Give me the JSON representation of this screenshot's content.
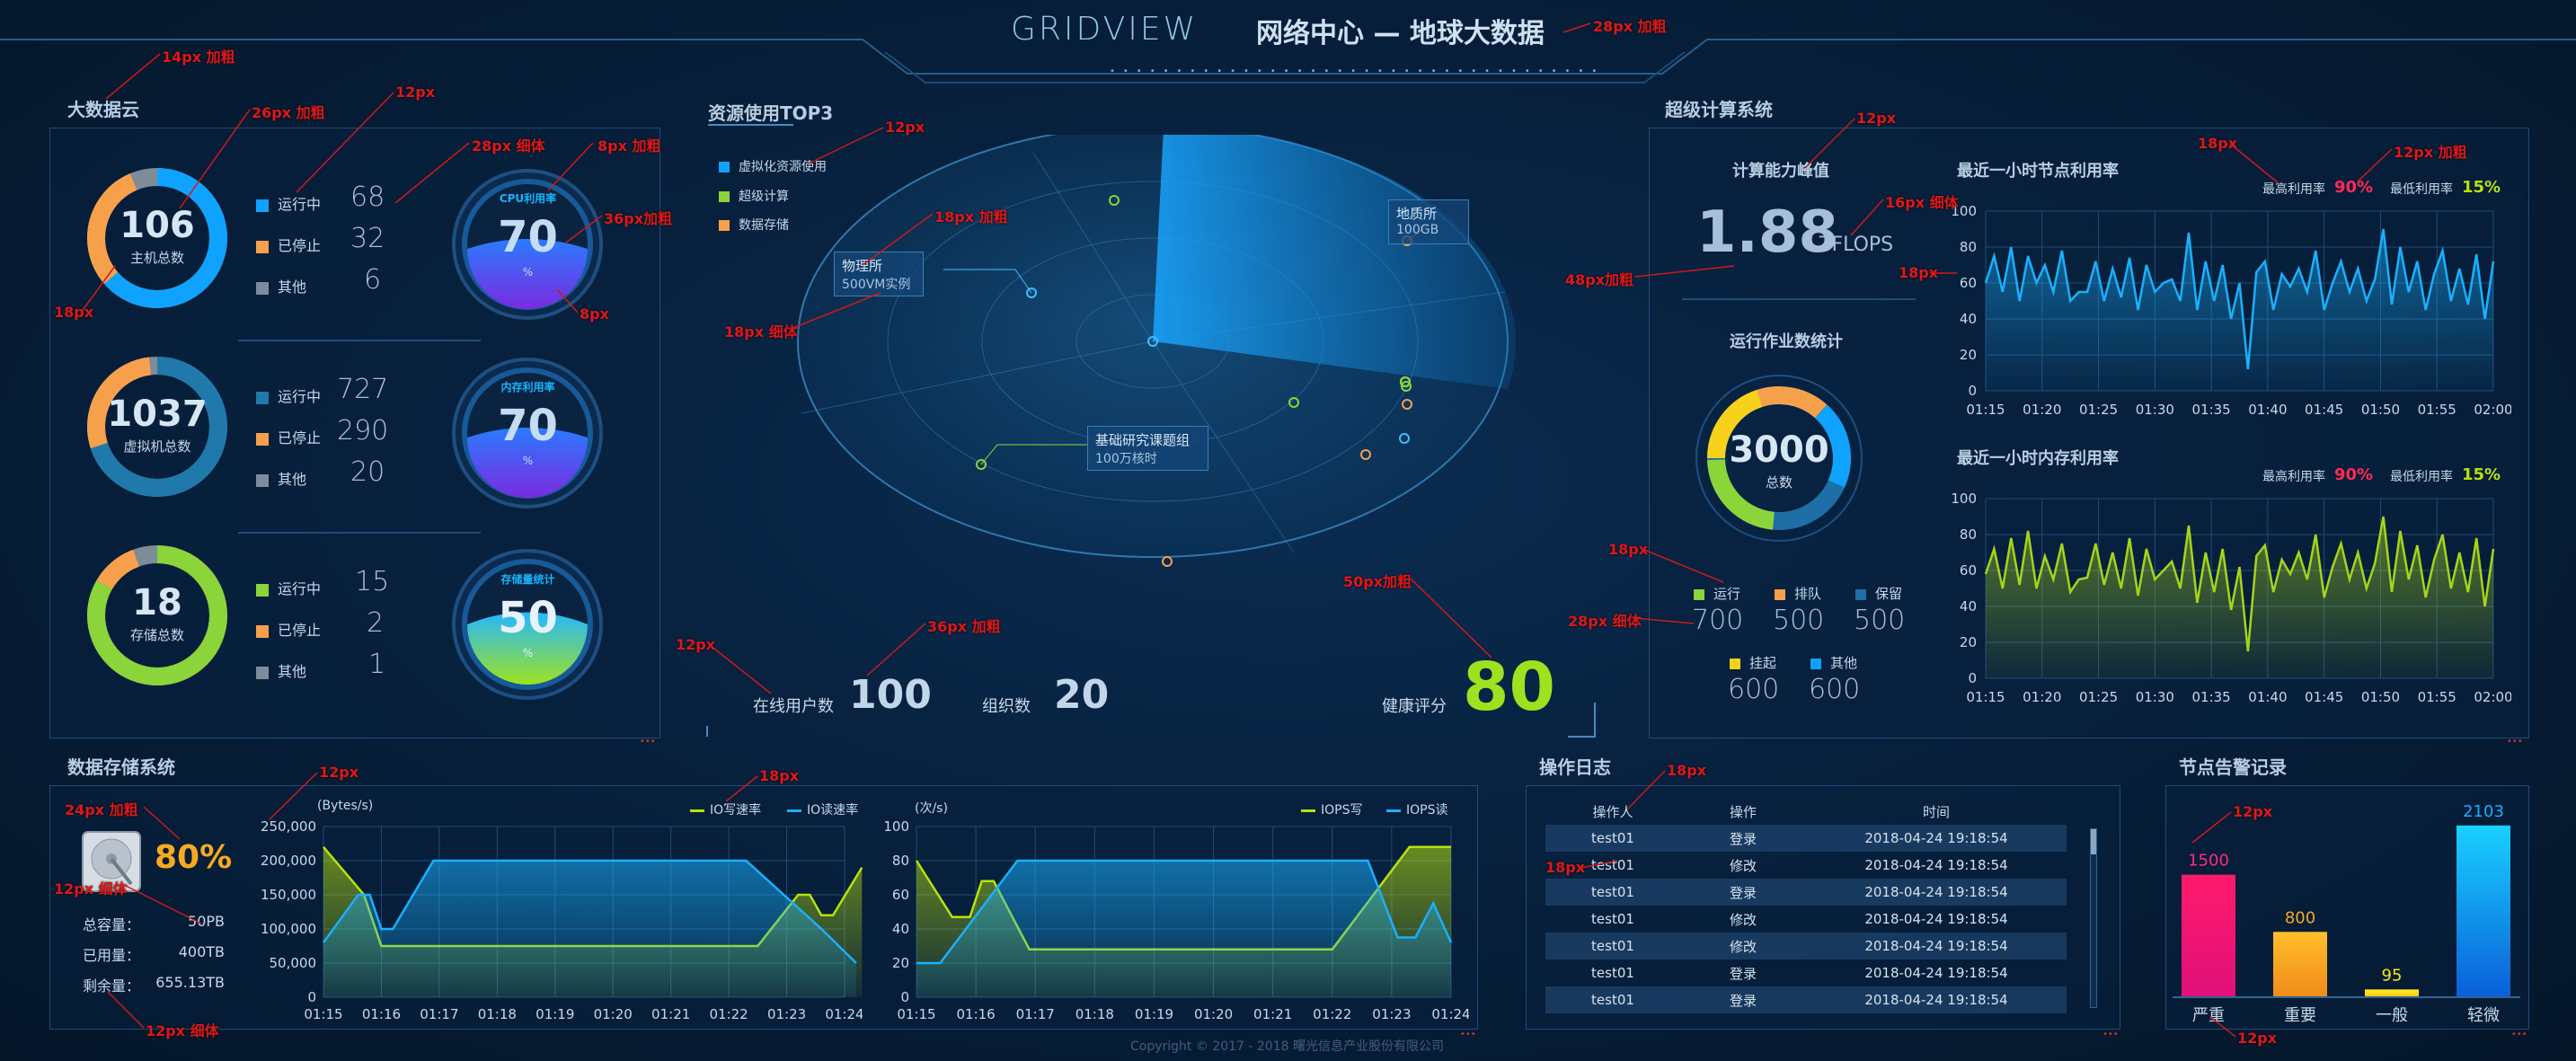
{
  "header": {
    "logo": "GRIDVIEW",
    "title": "网络中心 — 地球大数据"
  },
  "colors": {
    "blue": "#0fa3ff",
    "orange": "#f7a04b",
    "gray": "#7e8b99",
    "green": "#8bd43a",
    "yellow": "#f8d21a",
    "red": "#ff2a55",
    "lime": "#b8e20c"
  },
  "bigdata": {
    "title": "大数据云",
    "items": [
      {
        "value": "106",
        "label": "主机总数",
        "legend": [
          {
            "name": "运行中",
            "value": "68"
          },
          {
            "name": "已停止",
            "value": "32"
          },
          {
            "name": "其他",
            "value": "6"
          }
        ],
        "gauge_label": "CPU利用率",
        "gauge_value": "70",
        "gauge_unit": "%"
      },
      {
        "value": "1037",
        "label": "虚拟机总数",
        "legend": [
          {
            "name": "运行中",
            "value": "727"
          },
          {
            "name": "已停止",
            "value": "290"
          },
          {
            "name": "其他",
            "value": "20"
          }
        ],
        "gauge_label": "内存利用率",
        "gauge_value": "70",
        "gauge_unit": "%"
      },
      {
        "value": "18",
        "label": "存储总数",
        "legend": [
          {
            "name": "运行中",
            "value": "15"
          },
          {
            "name": "已停止",
            "value": "2"
          },
          {
            "name": "其他",
            "value": "1"
          }
        ],
        "gauge_label": "存储量统计",
        "gauge_value": "50",
        "gauge_unit": "%"
      }
    ]
  },
  "radar": {
    "title": "资源使用TOP3",
    "legend": [
      "虚拟化资源使用",
      "超级计算",
      "数据存储"
    ],
    "tags": [
      {
        "name": "物理所",
        "detail": "500VM实例"
      },
      {
        "name": "地质所",
        "detail": "100GB"
      },
      {
        "name": "基础研究课题组",
        "detail": "100万核时"
      }
    ],
    "online_label": "在线用户数",
    "online_value": "100",
    "org_label": "组织数",
    "org_value": "20",
    "health_label": "健康评分",
    "health_value": "80"
  },
  "supercomp": {
    "title": "超级计算系统",
    "peak_label": "计算能力峰值",
    "peak_value": "1.88",
    "peak_unit": "TFLOPS",
    "jobs_label": "运行作业数统计",
    "jobs_value": "3000",
    "jobs_sub": "总数",
    "jobs_legend": [
      {
        "name": "运行",
        "value": "700"
      },
      {
        "name": "排队",
        "value": "500"
      },
      {
        "name": "保留",
        "value": "500"
      },
      {
        "name": "挂起",
        "value": "600"
      },
      {
        "name": "其他",
        "value": "600"
      }
    ]
  },
  "node_charts": [
    {
      "title": "最近一小时节点利用率",
      "max_label": "最高利用率",
      "max_value": "90%",
      "min_label": "最低利用率",
      "min_value": "15%"
    },
    {
      "title": "最近一小时内存利用率",
      "max_label": "最高利用率",
      "max_value": "90%",
      "min_label": "最低利用率",
      "min_value": "15%"
    }
  ],
  "storage": {
    "title": "数据存储系统",
    "percent": "80%",
    "rows": [
      {
        "label": "总容量：",
        "value": "50PB"
      },
      {
        "label": "已用量：",
        "value": "400TB"
      },
      {
        "label": "剩余量：",
        "value": "655.13TB"
      }
    ]
  },
  "log": {
    "title": "操作日志",
    "headers": [
      "操作人",
      "操作",
      "时间"
    ],
    "rows": [
      [
        "test01",
        "登录",
        "2018-04-24 19:18:54"
      ],
      [
        "test01",
        "修改",
        "2018-04-24 19:18:54"
      ],
      [
        "test01",
        "登录",
        "2018-04-24 19:18:54"
      ],
      [
        "test01",
        "修改",
        "2018-04-24 19:18:54"
      ],
      [
        "test01",
        "修改",
        "2018-04-24 19:18:54"
      ],
      [
        "test01",
        "登录",
        "2018-04-24 19:18:54"
      ],
      [
        "test01",
        "登录",
        "2018-04-24 19:18:54"
      ]
    ]
  },
  "alerts": {
    "title": "节点告警记录"
  },
  "footer": {
    "copyright": "Copyright © 2017 - 2018 曙光信息产业股份有限公司"
  },
  "annotations": {
    "a1": "28px 加粗",
    "a2": "14px 加粗",
    "a3": "26px 加粗",
    "a4": "12px",
    "a5": "28px 细体",
    "a6": "8px 加粗",
    "a7": "36px加粗",
    "a8": "8px",
    "a9": "18px",
    "a10": "12px",
    "a11": "18px 加粗",
    "a12": "18px 细体",
    "a13": "12px",
    "a14": "48px加粗",
    "a15": "16px 细体",
    "a16": "18px",
    "a17": "18px",
    "a18": "12px 加粗",
    "a19": "18px",
    "a20": "28px 细体",
    "a21": "12px",
    "a22": "36px 加粗",
    "a23": "50px加粗",
    "a24": "24px 加粗",
    "a25": "12px 细体",
    "a26": "12px",
    "a27": "18px",
    "a28": "12px 细体",
    "a29": "18px",
    "a30": "18px",
    "a31": "12px",
    "a32": "12px",
    "a33": "12px"
  },
  "chart_data": [
    {
      "type": "line",
      "title": "最近一小时节点利用率",
      "x": [
        "01:15",
        "01:20",
        "01:25",
        "01:30",
        "01:35",
        "01:40",
        "01:45",
        "01:50",
        "01:55",
        "02:00"
      ],
      "ylim": [
        0,
        100
      ],
      "yticks": [
        0,
        20,
        40,
        60,
        80,
        100
      ],
      "series": [
        {
          "values": [
            60,
            75,
            55,
            80,
            50,
            75,
            60,
            70,
            55,
            78,
            50,
            55,
            55,
            72,
            50,
            68,
            52,
            74,
            45,
            70,
            55,
            60,
            62,
            50,
            88,
            45,
            72,
            50,
            70,
            40,
            60,
            12,
            66,
            72,
            45,
            65,
            58,
            68,
            55,
            78,
            45,
            60,
            72,
            55,
            68,
            50,
            62,
            90,
            48,
            80,
            55,
            72,
            45,
            65,
            78,
            50,
            68,
            48,
            76,
            40,
            72
          ]
        }
      ]
    },
    {
      "type": "line",
      "title": "最近一小时内存利用率",
      "x": [
        "01:15",
        "01:20",
        "01:25",
        "01:30",
        "01:35",
        "01:40",
        "01:45",
        "01:50",
        "01:55",
        "02:00"
      ],
      "ylim": [
        0,
        100
      ],
      "yticks": [
        0,
        20,
        40,
        60,
        80,
        100
      ],
      "series": [
        {
          "values": [
            58,
            72,
            50,
            78,
            52,
            82,
            50,
            68,
            55,
            75,
            48,
            55,
            56,
            75,
            52,
            70,
            50,
            78,
            46,
            72,
            55,
            60,
            65,
            50,
            85,
            42,
            70,
            48,
            72,
            38,
            62,
            15,
            68,
            74,
            48,
            66,
            58,
            70,
            55,
            80,
            45,
            62,
            75,
            55,
            70,
            50,
            64,
            90,
            48,
            82,
            55,
            74,
            45,
            66,
            80,
            50,
            70,
            48,
            78,
            40,
            72
          ]
        }
      ]
    },
    {
      "type": "area",
      "ylabel": "(Bytes/s)",
      "x": [
        "01:15",
        "01:16",
        "01:17",
        "01:18",
        "01:19",
        "01:20",
        "01:21",
        "01:22",
        "01:23",
        "01:24"
      ],
      "ylim": [
        0,
        250000
      ],
      "yticks": [
        0,
        50000,
        100000,
        150000,
        200000,
        250000
      ],
      "ytick_labels": [
        "0",
        "50,000",
        "100,000",
        "150,000",
        "200,000",
        "250,000"
      ],
      "series": [
        {
          "name": "IO写速率",
          "points": [
            [
              0,
              220000
            ],
            [
              0.7,
              150000
            ],
            [
              1,
              75000
            ],
            [
              1.6,
              75000
            ],
            [
              7.5,
              75000
            ],
            [
              8.2,
              150000
            ],
            [
              8.4,
              150000
            ],
            [
              8.6,
              120000
            ],
            [
              8.8,
              120000
            ],
            [
              9.3,
              190000
            ]
          ]
        },
        {
          "name": "IO读速率",
          "points": [
            [
              0,
              80000
            ],
            [
              0.6,
              150000
            ],
            [
              0.8,
              150000
            ],
            [
              1,
              100000
            ],
            [
              1.2,
              100000
            ],
            [
              1.9,
              200000
            ],
            [
              7.3,
              200000
            ],
            [
              8.6,
              100000
            ],
            [
              9.2,
              50000
            ]
          ]
        }
      ]
    },
    {
      "type": "area",
      "ylabel": "(次/s)",
      "x": [
        "01:15",
        "01:16",
        "01:17",
        "01:18",
        "01:19",
        "01:20",
        "01:21",
        "01:22",
        "01:23",
        "01:24"
      ],
      "ylim": [
        0,
        100
      ],
      "yticks": [
        0,
        20,
        40,
        60,
        80,
        100
      ],
      "series": [
        {
          "name": "IOPS写",
          "points": [
            [
              0,
              80
            ],
            [
              0.6,
              47
            ],
            [
              0.9,
              47
            ],
            [
              1.1,
              68
            ],
            [
              1.3,
              68
            ],
            [
              1.9,
              28
            ],
            [
              7.0,
              28
            ],
            [
              8.3,
              88
            ],
            [
              9.0,
              88
            ]
          ]
        },
        {
          "name": "IOPS读",
          "points": [
            [
              0,
              20
            ],
            [
              0.4,
              20
            ],
            [
              1.7,
              80
            ],
            [
              7.6,
              80
            ],
            [
              8.1,
              35
            ],
            [
              8.4,
              35
            ],
            [
              8.7,
              55
            ],
            [
              9.0,
              32
            ]
          ]
        }
      ]
    },
    {
      "type": "bar",
      "title": "节点告警记录",
      "categories": [
        "严重",
        "重要",
        "一般",
        "轻微"
      ],
      "values": [
        1500,
        800,
        95,
        2103
      ],
      "ylim": [
        0,
        2200
      ]
    }
  ]
}
